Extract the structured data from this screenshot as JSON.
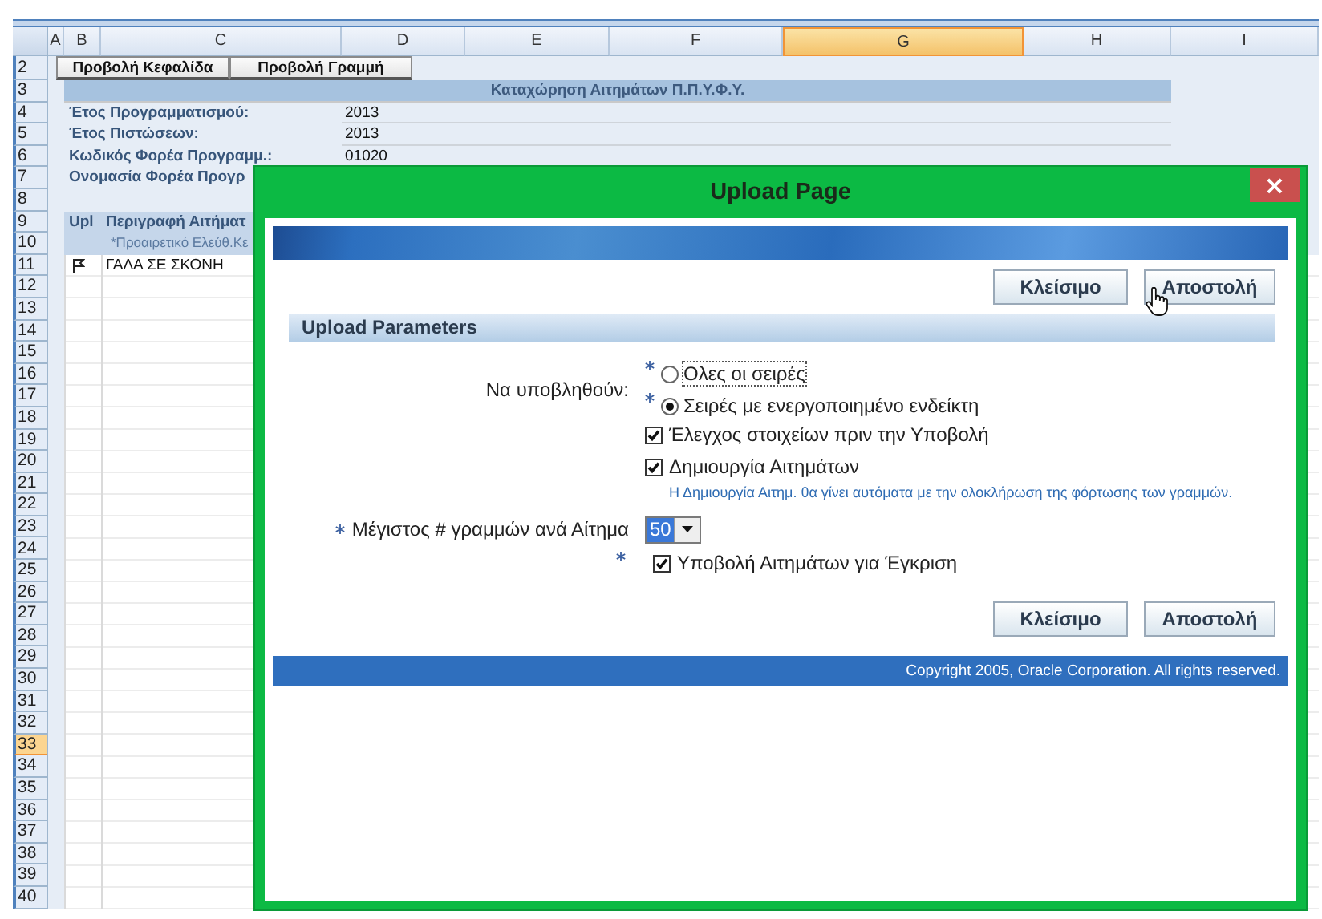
{
  "sheet": {
    "columns": [
      {
        "label": "A",
        "selected": false
      },
      {
        "label": "B",
        "selected": false
      },
      {
        "label": "C",
        "selected": false
      },
      {
        "label": "D",
        "selected": false
      },
      {
        "label": "E",
        "selected": false
      },
      {
        "label": "F",
        "selected": false
      },
      {
        "label": "G",
        "selected": true
      },
      {
        "label": "H",
        "selected": false
      },
      {
        "label": "I",
        "selected": false
      }
    ],
    "rows": [
      {
        "label": "2",
        "selected": false
      },
      {
        "label": "3",
        "selected": false
      },
      {
        "label": "4",
        "selected": false
      },
      {
        "label": "5",
        "selected": false
      },
      {
        "label": "6",
        "selected": false
      },
      {
        "label": "7",
        "selected": false
      },
      {
        "label": "8",
        "selected": false
      },
      {
        "label": "9",
        "selected": false
      },
      {
        "label": "10",
        "selected": false
      },
      {
        "label": "11",
        "selected": false
      },
      {
        "label": "12",
        "selected": false
      },
      {
        "label": "13",
        "selected": false
      },
      {
        "label": "14",
        "selected": false
      },
      {
        "label": "15",
        "selected": false
      },
      {
        "label": "16",
        "selected": false
      },
      {
        "label": "17",
        "selected": false
      },
      {
        "label": "18",
        "selected": false
      },
      {
        "label": "19",
        "selected": false
      },
      {
        "label": "20",
        "selected": false
      },
      {
        "label": "21",
        "selected": false
      },
      {
        "label": "22",
        "selected": false
      },
      {
        "label": "23",
        "selected": false
      },
      {
        "label": "24",
        "selected": false
      },
      {
        "label": "25",
        "selected": false
      },
      {
        "label": "26",
        "selected": false
      },
      {
        "label": "27",
        "selected": false
      },
      {
        "label": "28",
        "selected": false
      },
      {
        "label": "29",
        "selected": false
      },
      {
        "label": "30",
        "selected": false
      },
      {
        "label": "31",
        "selected": false
      },
      {
        "label": "32",
        "selected": false
      },
      {
        "label": "33",
        "selected": true
      },
      {
        "label": "34",
        "selected": false
      },
      {
        "label": "35",
        "selected": false
      },
      {
        "label": "36",
        "selected": false
      },
      {
        "label": "37",
        "selected": false
      },
      {
        "label": "38",
        "selected": false
      },
      {
        "label": "39",
        "selected": false
      },
      {
        "label": "40",
        "selected": false
      }
    ],
    "buttons": [
      "Προβολή Κεφαλίδα",
      "Προβολή Γραμμή"
    ],
    "title": "Καταχώρηση Αιτημάτων Π.Π.Υ.Φ.Υ.",
    "fields": [
      {
        "label": "Έτος Προγραμματισμού:",
        "value": "2013"
      },
      {
        "label": "Έτος Πιστώσεων:",
        "value": "2013"
      },
      {
        "label": "Κωδικός Φορέα Προγραμμ.:",
        "value": "01020"
      },
      {
        "label": "Ονομασία Φορέα Προγρ"
      }
    ],
    "table": {
      "upload_header": "Upl",
      "description_header": "Περιγραφή Αιτήματ",
      "description_note": "*Προαιρετικό Ελεύθ.Κε",
      "rows": [
        {
          "flagged": true,
          "description": "ΓΑΛΑ ΣΕ ΣΚΟΝΗ"
        }
      ]
    }
  },
  "dialog": {
    "title": "Upload Page",
    "close": "×",
    "top_buttons": [
      "Κλείσιμο",
      "Αποστολή"
    ],
    "section": "Upload Parameters",
    "form": [
      {
        "kind": "radio_group",
        "caption": "Να υποβληθούν:",
        "options": [
          {
            "label": "Ολες οι σειρές",
            "required": true,
            "selected": false
          },
          {
            "label": "Σειρές με ενεργοποιημένο ενδείκτη",
            "required": true,
            "selected": true
          }
        ]
      },
      {
        "kind": "checkbox",
        "label": "Έλεγχος στοιχείων πριν την Υποβολή",
        "checked": true
      },
      {
        "kind": "checkbox",
        "label": "Δημιουργία Αιτημάτων",
        "checked": true
      },
      {
        "kind": "hint",
        "text": "Η Δημιουργία Αιτημ. θα γίνει αυτόματα με την ολοκλήρωση της φόρτωσης των γραμμών."
      },
      {
        "kind": "select",
        "caption": "Μέγιστος # γραμμών ανά Αίτημα",
        "required": true,
        "value": "50"
      },
      {
        "kind": "checkbox",
        "label": "Υποβολή Αιτημάτων για Έγκριση",
        "checked": true,
        "required": true
      }
    ],
    "bottom_buttons": [
      "Κλείσιμο",
      "Αποστολή"
    ],
    "copyright": "Copyright 2005, Oracle Corporation. All rights reserved."
  }
}
